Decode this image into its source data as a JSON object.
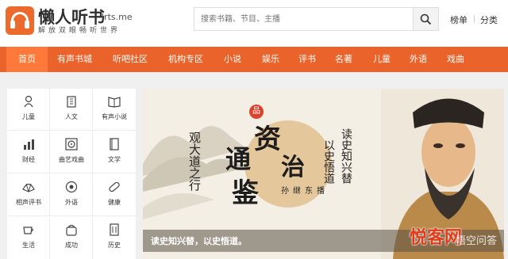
{
  "brand": {
    "title": "懒人听书",
    "domain": "lrts.me",
    "slogan": "解放双眼畅听世界"
  },
  "search": {
    "placeholder": "搜索书籍、节目、主播"
  },
  "header_links": [
    "榜单",
    "分类"
  ],
  "nav": {
    "items": [
      "首页",
      "有声书城",
      "听吧社区",
      "机构专区",
      "小说",
      "娱乐",
      "评书",
      "名著",
      "儿童",
      "外语",
      "戏曲"
    ],
    "active": "首页"
  },
  "categories": [
    {
      "label": "儿童",
      "icon": "child-icon"
    },
    {
      "label": "人文",
      "icon": "building-icon"
    },
    {
      "label": "有声小说",
      "icon": "book-open-icon"
    },
    {
      "label": "财经",
      "icon": "bar-chart-icon"
    },
    {
      "label": "曲艺戏曲",
      "icon": "disc-icon"
    },
    {
      "label": "文学",
      "icon": "book-icon"
    },
    {
      "label": "相声评书",
      "icon": "fan-icon"
    },
    {
      "label": "外语",
      "icon": "globe-icon"
    },
    {
      "label": "健康",
      "icon": "pill-icon"
    },
    {
      "label": "生活",
      "icon": "cup-icon"
    },
    {
      "label": "成功",
      "icon": "bag-icon"
    },
    {
      "label": "历史",
      "icon": "scroll-icon"
    }
  ],
  "banner": {
    "seal": "品",
    "title_chars": [
      "资",
      "治",
      "通",
      "鉴"
    ],
    "left_vertical": "观大道之行",
    "author": "孙继东播",
    "right_vertical_1": "读史知兴替",
    "right_vertical_2": "以史悟道",
    "caption": "读史知兴替，以史悟道。"
  },
  "watermark": {
    "text": "悦客网",
    "sub": "悟空问答"
  },
  "colors": {
    "brand_orange": "#ea632a",
    "active_nav": "#ff7a3a"
  }
}
